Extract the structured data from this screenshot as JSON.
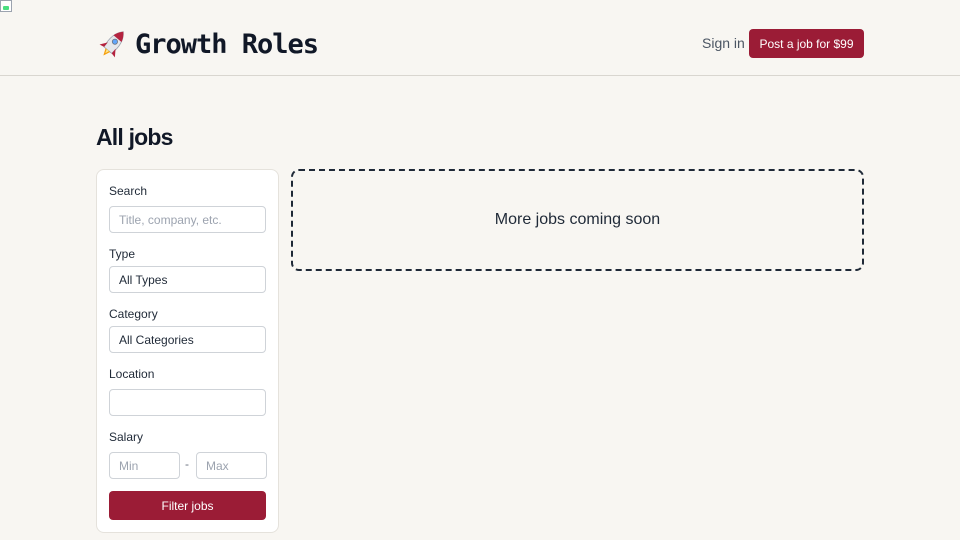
{
  "header": {
    "brand_name": "Growth Roles",
    "brand_icon": "rocket-icon",
    "sign_in_label": "Sign in",
    "post_job_label": "Post a job for $99",
    "accent_color": "#9b1c36"
  },
  "page": {
    "title": "All jobs"
  },
  "filters": {
    "search_label": "Search",
    "search_placeholder": "Title, company, etc.",
    "search_value": "",
    "type_label": "Type",
    "type_value": "All Types",
    "category_label": "Category",
    "category_value": "All Categories",
    "location_label": "Location",
    "location_value": "",
    "salary_label": "Salary",
    "salary_min_placeholder": "Min",
    "salary_separator": "-",
    "salary_max_placeholder": "Max",
    "filter_button_label": "Filter jobs"
  },
  "results": {
    "empty_message": "More jobs coming soon"
  }
}
